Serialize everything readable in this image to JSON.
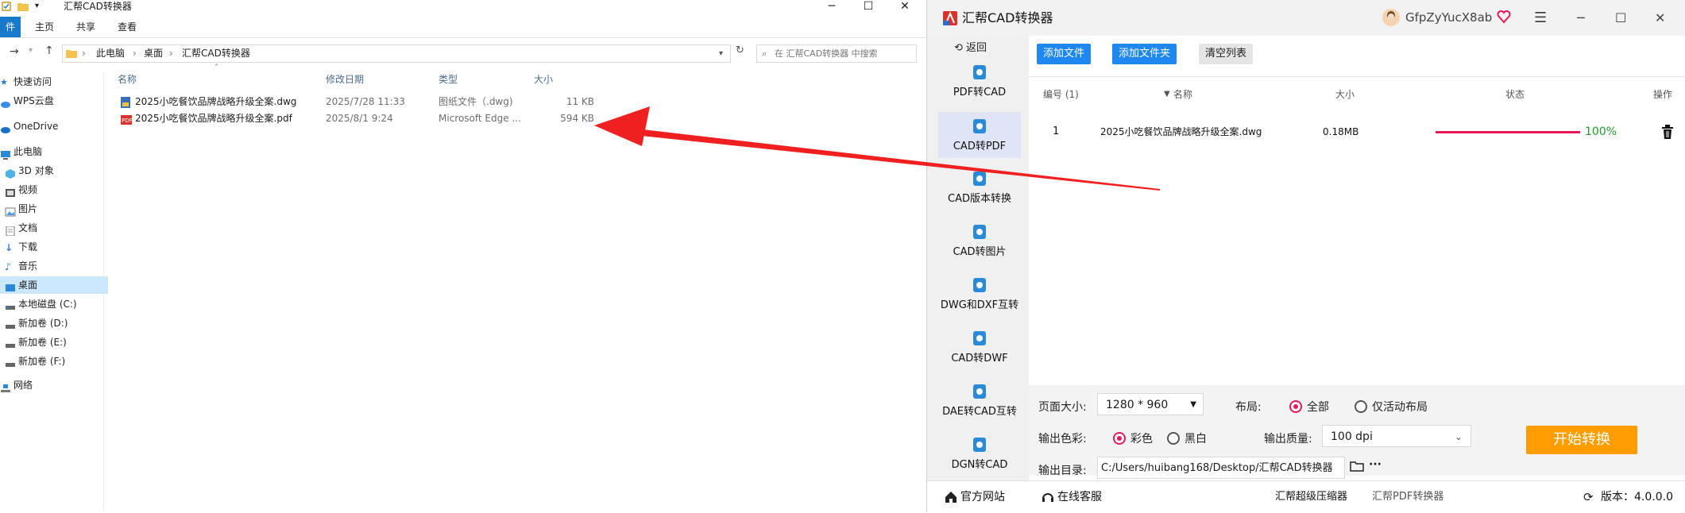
{
  "explorer": {
    "title": "汇帮CAD转换器",
    "ribbon": {
      "file": "件",
      "home": "主页",
      "share": "共享",
      "view": "查看"
    },
    "breadcrumb": [
      "此电脑",
      "桌面",
      "汇帮CAD转换器"
    ],
    "search_placeholder": "在 汇帮CAD转换器 中搜索",
    "nav": [
      {
        "label": "快速访问",
        "icon": "star-icon"
      },
      {
        "label": "WPS云盘",
        "icon": "cloud-icon"
      },
      {
        "label": "OneDrive",
        "icon": "onedrive-icon"
      },
      {
        "label": "此电脑",
        "icon": "computer-icon"
      },
      {
        "label": "3D 对象",
        "icon": "cube-icon"
      },
      {
        "label": "视频",
        "icon": "video-icon"
      },
      {
        "label": "图片",
        "icon": "picture-icon"
      },
      {
        "label": "文档",
        "icon": "document-icon"
      },
      {
        "label": "下载",
        "icon": "download-icon"
      },
      {
        "label": "音乐",
        "icon": "music-icon"
      },
      {
        "label": "桌面",
        "icon": "desktop-icon"
      },
      {
        "label": "本地磁盘 (C:)",
        "icon": "drive-icon"
      },
      {
        "label": "新加卷 (D:)",
        "icon": "drive-icon"
      },
      {
        "label": "新加卷 (E:)",
        "icon": "drive-icon"
      },
      {
        "label": "新加卷 (F:)",
        "icon": "drive-icon"
      },
      {
        "label": "网络",
        "icon": "network-icon"
      }
    ],
    "columns": {
      "name": "名称",
      "modified": "修改日期",
      "type": "类型",
      "size": "大小"
    },
    "files": [
      {
        "name": "2025小吃餐饮品牌战略升级全案.dwg",
        "modified": "2025/7/28 11:33",
        "type": "图纸文件（.dwg)",
        "size": "11 KB",
        "icon": "dwg-file-icon"
      },
      {
        "name": "2025小吃餐饮品牌战略升级全案.pdf",
        "modified": "2025/8/1 9:24",
        "type": "Microsoft Edge ...",
        "size": "594 KB",
        "icon": "pdf-file-icon"
      }
    ]
  },
  "converter": {
    "title": "汇帮CAD转换器",
    "username": "GfpZyYucX8ab",
    "back_label": "返回",
    "sidebar": [
      {
        "label": "PDF转CAD",
        "selected": false
      },
      {
        "label": "CAD转PDF",
        "selected": true
      },
      {
        "label": "CAD版本转换",
        "selected": false
      },
      {
        "label": "CAD转图片",
        "selected": false
      },
      {
        "label": "DWG和DXF互转",
        "selected": false
      },
      {
        "label": "CAD转DWF",
        "selected": false
      },
      {
        "label": "DAE转CAD互转",
        "selected": false
      },
      {
        "label": "DGN转CAD",
        "selected": false
      }
    ],
    "toolbar": {
      "add_file": "添加文件",
      "add_folder": "添加文件夹",
      "clear_list": "清空列表"
    },
    "table_head": {
      "index": "编号 (1)",
      "name": "名称",
      "size": "大小",
      "status": "状态",
      "action": "操作"
    },
    "rows": [
      {
        "index": "1",
        "name": "2025小吃餐饮品牌战略升级全案.dwg",
        "size": "0.18MB",
        "progress": 100,
        "progress_label": "100%"
      }
    ],
    "options": {
      "page_size_label": "页面大小:",
      "page_size_value": "1280 * 960",
      "layout_label": "布局:",
      "layout_all": "全部",
      "layout_active": "仅活动布局",
      "color_label": "输出色彩:",
      "color_color": "彩色",
      "color_bw": "黑白",
      "quality_label": "输出质量:",
      "quality_value": "100 dpi",
      "dir_label": "输出目录:",
      "dir_value": "C:/Users/huibang168/Desktop/汇帮CAD转换器",
      "start_button": "开始转换"
    },
    "bottom": {
      "website": "官方网站",
      "service": "在线客服",
      "compressor": "汇帮超级压缩器",
      "pdf_converter": "汇帮PDF转换器",
      "version": "版本：4.0.0.0"
    },
    "colors": {
      "accent_blue": "#1e88f0",
      "progress_pink": "#e6195a",
      "start_orange": "#ff9d00",
      "progress_green": "#1f9d2a"
    }
  }
}
